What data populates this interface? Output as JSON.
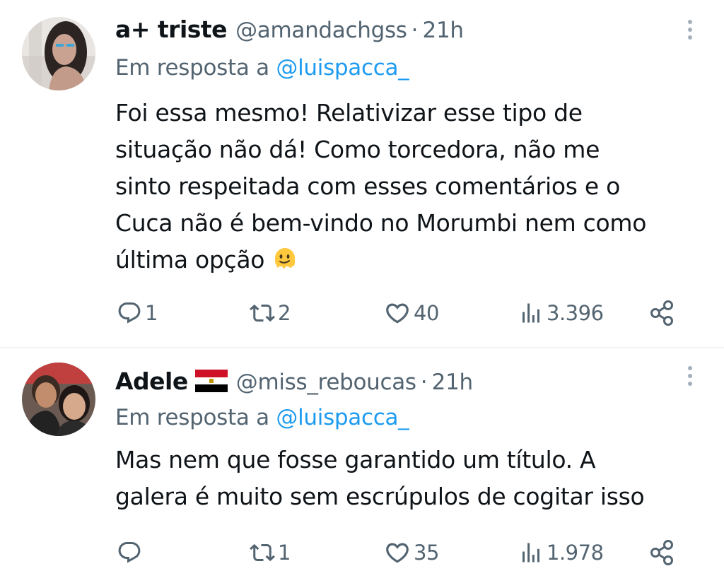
{
  "tweets": [
    {
      "display_name": "a+ triste",
      "handle": "@amandachgss",
      "separator": "·",
      "time": "21h",
      "reply_prefix": "Em resposta a",
      "reply_to": "@luispacca_",
      "text": "Foi essa mesmo! Relativizar esse tipo de\nsituação não dá! Como torcedora, não me\nsinto respeitada com esses comentários e o\nCuca não é bem-vindo no Morumbi nem como\núltima opção",
      "emoji": "melting-face",
      "replies": "1",
      "retweets": "2",
      "likes": "40",
      "views": "3.396"
    },
    {
      "display_name": "Adele",
      "flag": "egypt-flag",
      "handle": "@miss_reboucas",
      "separator": "·",
      "time": "21h",
      "reply_prefix": "Em resposta a",
      "reply_to": "@luispacca_",
      "text": "Mas nem que fosse garantido um título.  A\ngalera é muito sem escrúpulos de cogitar isso",
      "replies": "",
      "retweets": "1",
      "likes": "35",
      "views": "1.978"
    }
  ],
  "colors": {
    "text": "#0f1419",
    "secondary": "#536471",
    "link": "#1d9bf0",
    "divider": "#eff3f4"
  }
}
